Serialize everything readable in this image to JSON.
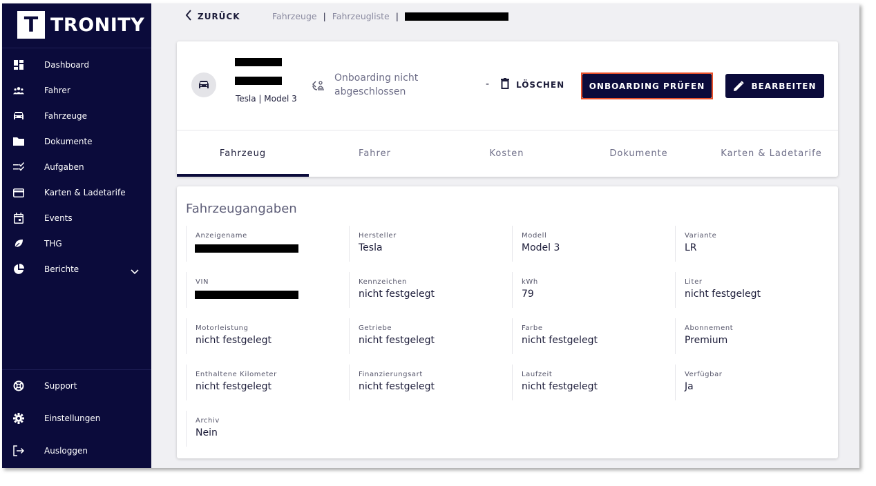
{
  "brand": {
    "logo_letter": "T",
    "name": "TRONITY"
  },
  "sidebar": {
    "items": [
      {
        "label": "Dashboard",
        "icon": "dashboard-icon"
      },
      {
        "label": "Fahrer",
        "icon": "people-icon"
      },
      {
        "label": "Fahrzeuge",
        "icon": "car-icon"
      },
      {
        "label": "Dokumente",
        "icon": "folder-icon"
      },
      {
        "label": "Aufgaben",
        "icon": "checklist-icon"
      },
      {
        "label": "Karten & Ladetarife",
        "icon": "card-icon"
      },
      {
        "label": "Events",
        "icon": "calendar-icon"
      },
      {
        "label": "THG",
        "icon": "leaf-icon"
      },
      {
        "label": "Berichte",
        "icon": "pie-chart-icon"
      }
    ],
    "bottom_items": [
      {
        "label": "Support",
        "icon": "support-icon"
      },
      {
        "label": "Einstellungen",
        "icon": "gear-icon"
      },
      {
        "label": "Ausloggen",
        "icon": "logout-icon"
      }
    ]
  },
  "topbar": {
    "back_label": "ZURÜCK",
    "breadcrumbs": [
      "Fahrzeuge",
      "Fahrzeugliste"
    ],
    "separator": "|"
  },
  "vehicle": {
    "subtitle": "Tesla | Model 3",
    "onboarding_status": "Onboarding nicht abgeschlossen",
    "dash": "-",
    "delete_label": "LÖSCHEN",
    "check_label": "ONBOARDING PRÜFEN",
    "edit_label": "BEARBEITEN"
  },
  "tabs": [
    "Fahrzeug",
    "Fahrer",
    "Kosten",
    "Dokumente",
    "Karten & Ladetarife"
  ],
  "active_tab": 0,
  "details": {
    "title": "Fahrzeugangaben",
    "fields": [
      {
        "label": "Anzeigename",
        "value": ""
      },
      {
        "label": "Hersteller",
        "value": "Tesla"
      },
      {
        "label": "Modell",
        "value": "Model 3"
      },
      {
        "label": "Variante",
        "value": "LR"
      },
      {
        "label": "VIN",
        "value": ""
      },
      {
        "label": "Kennzeichen",
        "value": "nicht festgelegt"
      },
      {
        "label": "kWh",
        "value": "79"
      },
      {
        "label": "Liter",
        "value": "nicht festgelegt"
      },
      {
        "label": "Motorleistung",
        "value": "nicht festgelegt"
      },
      {
        "label": "Getriebe",
        "value": "nicht festgelegt"
      },
      {
        "label": "Farbe",
        "value": "nicht festgelegt"
      },
      {
        "label": "Abonnement",
        "value": "Premium"
      },
      {
        "label": "Enthaltene Kilometer",
        "value": "nicht festgelegt"
      },
      {
        "label": "Finanzierungsart",
        "value": "nicht festgelegt"
      },
      {
        "label": "Laufzeit",
        "value": "nicht festgelegt"
      },
      {
        "label": "Verfügbar",
        "value": "Ja"
      },
      {
        "label": "Archiv",
        "value": "Nein"
      }
    ]
  },
  "colors": {
    "sidebar_bg": "#0b0b3b",
    "primary": "#0b0b3b",
    "highlight": "#e8502a",
    "page_bg": "#f0f0f3"
  }
}
